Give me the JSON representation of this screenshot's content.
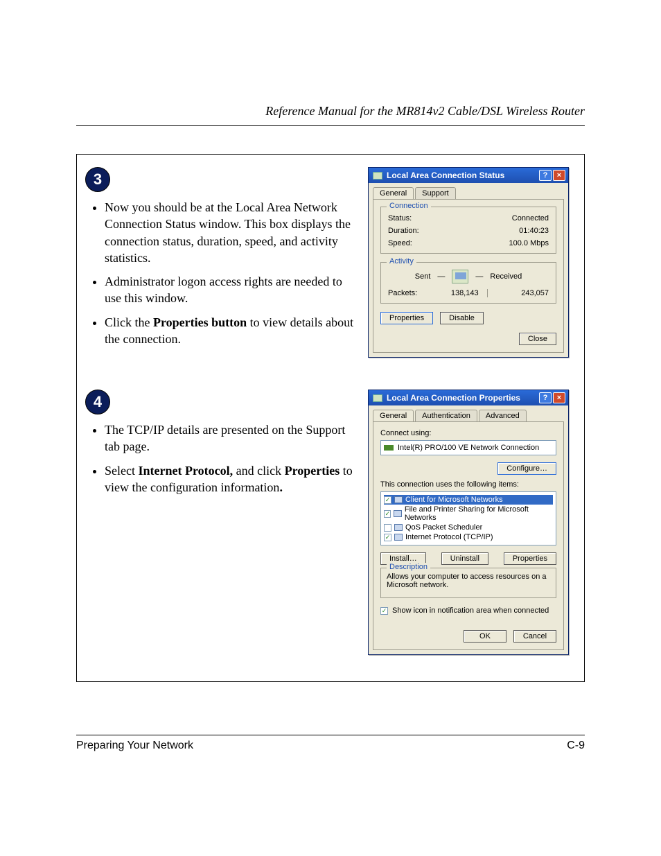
{
  "header_title": "Reference Manual for the MR814v2 Cable/DSL Wireless Router",
  "step3": {
    "number": "3",
    "bullet1_a": "Now you should be at the Local Area Network Connection Status window. This box displays the connection status, duration, speed, and activity statistics.",
    "bullet2": "Administrator logon access rights are needed to use this window.",
    "bullet3_a": "Click the ",
    "bullet3_b": "Properties button",
    "bullet3_c": " to view details about the connection."
  },
  "step4": {
    "number": "4",
    "bullet1": "The TCP/IP details are presented on the Support tab page.",
    "bullet2_a": "Select ",
    "bullet2_b": "Internet Protocol,",
    "bullet2_c": " and click ",
    "bullet2_d": "Properties",
    "bullet2_e": " to view the configuration information",
    "bullet2_f": "."
  },
  "dlg_status": {
    "title": "Local Area Connection Status",
    "tab_general": "General",
    "tab_support": "Support",
    "grp_connection": "Connection",
    "lbl_status": "Status:",
    "val_status": "Connected",
    "lbl_duration": "Duration:",
    "val_duration": "01:40:23",
    "lbl_speed": "Speed:",
    "val_speed": "100.0 Mbps",
    "grp_activity": "Activity",
    "lbl_sent": "Sent",
    "lbl_received": "Received",
    "lbl_packets": "Packets:",
    "val_sent": "138,143",
    "val_received": "243,057",
    "btn_properties": "Properties",
    "btn_disable": "Disable",
    "btn_close": "Close"
  },
  "dlg_props": {
    "title": "Local Area Connection Properties",
    "tab_general": "General",
    "tab_auth": "Authentication",
    "tab_adv": "Advanced",
    "lbl_connect_using": "Connect using:",
    "val_adapter": "Intel(R) PRO/100 VE Network Connection",
    "btn_configure": "Configure…",
    "lbl_uses_items": "This connection uses the following items:",
    "item_client": "Client for Microsoft Networks",
    "item_fps": "File and Printer Sharing for Microsoft Networks",
    "item_qos": "QoS Packet Scheduler",
    "item_tcpip": "Internet Protocol (TCP/IP)",
    "btn_install": "Install…",
    "btn_uninstall": "Uninstall",
    "btn_properties": "Properties",
    "grp_description": "Description",
    "desc_text": "Allows your computer to access resources on a Microsoft network.",
    "chk_show_icon": "Show icon in notification area when connected",
    "btn_ok": "OK",
    "btn_cancel": "Cancel"
  },
  "footer_left": "Preparing Your Network",
  "footer_right": "C-9"
}
